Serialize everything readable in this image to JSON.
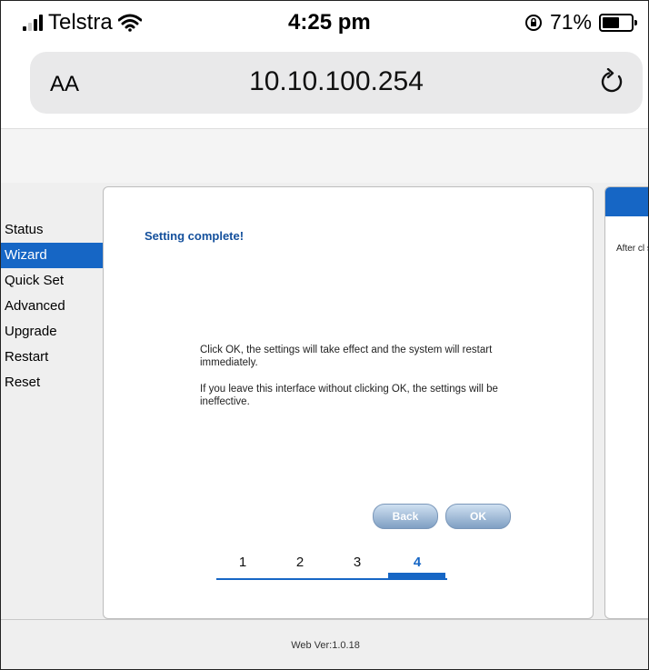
{
  "status_bar": {
    "carrier": "Telstra",
    "time": "4:25 pm",
    "battery_percent": "71%",
    "battery_level": 0.71,
    "icons": [
      "signal-icon",
      "wifi-icon",
      "orientation-lock-icon",
      "battery-icon"
    ]
  },
  "address_bar": {
    "text_size_label": "AA",
    "url": "10.10.100.254",
    "icons": [
      "reload-icon"
    ]
  },
  "menu": {
    "items": [
      {
        "label": "Status"
      },
      {
        "label": "Wizard"
      },
      {
        "label": "Quick Set"
      },
      {
        "label": "Advanced"
      },
      {
        "label": "Upgrade"
      },
      {
        "label": "Restart"
      },
      {
        "label": "Reset"
      }
    ],
    "active": "Wizard"
  },
  "wizard": {
    "title": "Setting complete!",
    "message1": "Click OK, the settings will take effect and the system will restart immediately.",
    "message2": "If you leave this interface without clicking OK, the settings will be ineffective.",
    "back_label": "Back",
    "ok_label": "OK",
    "steps": [
      "1",
      "2",
      "3",
      "4"
    ],
    "current_step": "4"
  },
  "side_panel": {
    "text": "After cl system immedi"
  },
  "footer": {
    "version": "Web Ver:1.0.18"
  },
  "colors": {
    "accent": "#1666c5",
    "title": "#14509c",
    "button": "#8fb0d4"
  }
}
